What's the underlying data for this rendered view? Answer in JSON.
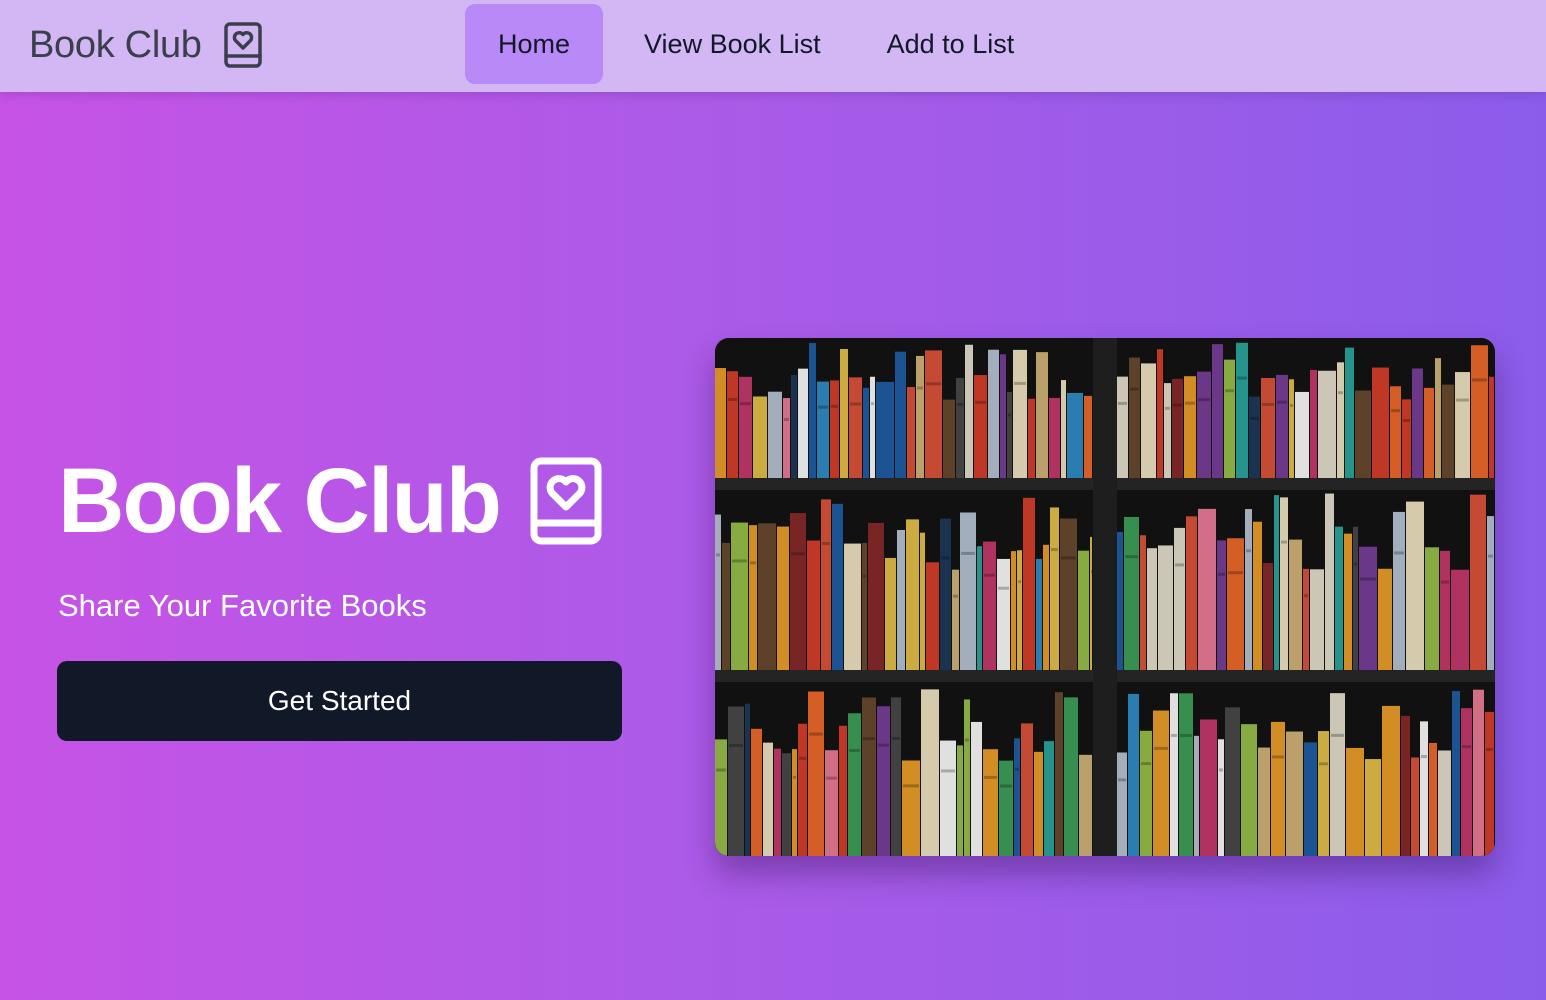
{
  "nav": {
    "brand": "Book Club",
    "links": [
      {
        "label": "Home",
        "active": true
      },
      {
        "label": "View Book List",
        "active": false
      },
      {
        "label": "Add to List",
        "active": false
      }
    ]
  },
  "hero": {
    "title": "Book Club",
    "subtitle": "Share Your Favorite Books",
    "cta_label": "Get Started",
    "image": "bookshelf-photo"
  },
  "icons": {
    "brand_icon": "book-heart-icon",
    "hero_icon": "book-heart-icon"
  },
  "colors": {
    "nav_background": "#d3b7f5",
    "nav_active": "#b98af7",
    "background_gradient": [
      "#c653e6",
      "#8b5cea"
    ],
    "cta_background": "#111827",
    "brand_text": "#3a3f4c"
  }
}
